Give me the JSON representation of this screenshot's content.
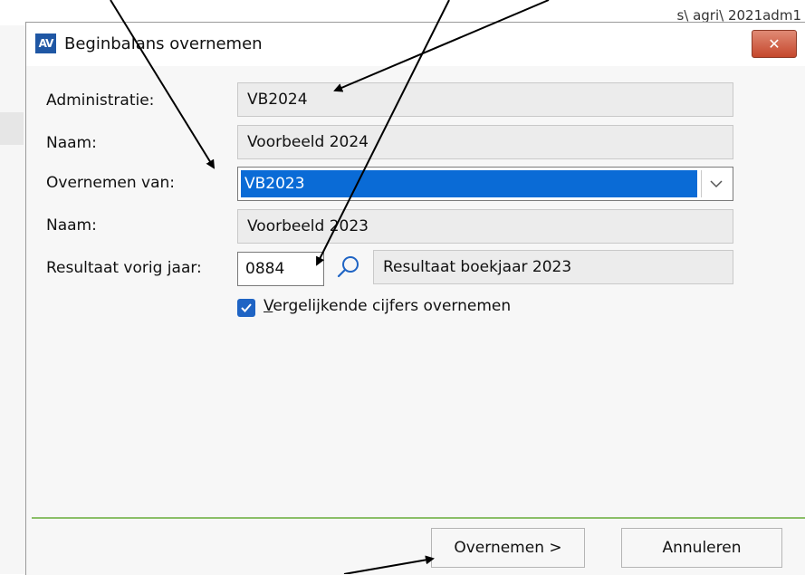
{
  "background": {
    "partial_text": "s\\ agri\\ 2021adm1"
  },
  "dialog": {
    "icon_glyph": "AV",
    "title": "Beginbalans overnemen",
    "close_label": "✕"
  },
  "form": {
    "administratie_label": "Administratie:",
    "administratie_value": "VB2024",
    "naam1_label": "Naam:",
    "naam1_value": "Voorbeeld 2024",
    "overnemen_van_label": "Overnemen van:",
    "overnemen_van_value": "VB2023",
    "naam2_label": "Naam:",
    "naam2_value": "Voorbeeld 2023",
    "resultaat_label": "Resultaat vorig jaar:",
    "resultaat_code": "0884",
    "resultaat_desc": "Resultaat boekjaar 2023",
    "vergelijkende_checked": true,
    "vergelijkende_label_first": "V",
    "vergelijkende_label_rest": "ergelijkende cijfers overnemen"
  },
  "buttons": {
    "overnemen": "Overnemen >",
    "annuleren": "Annuleren"
  },
  "colors": {
    "selection": "#0a6bd6",
    "close": "#c5472c",
    "checkbox": "#1f64c4",
    "footer_line": "#8bbf68"
  }
}
